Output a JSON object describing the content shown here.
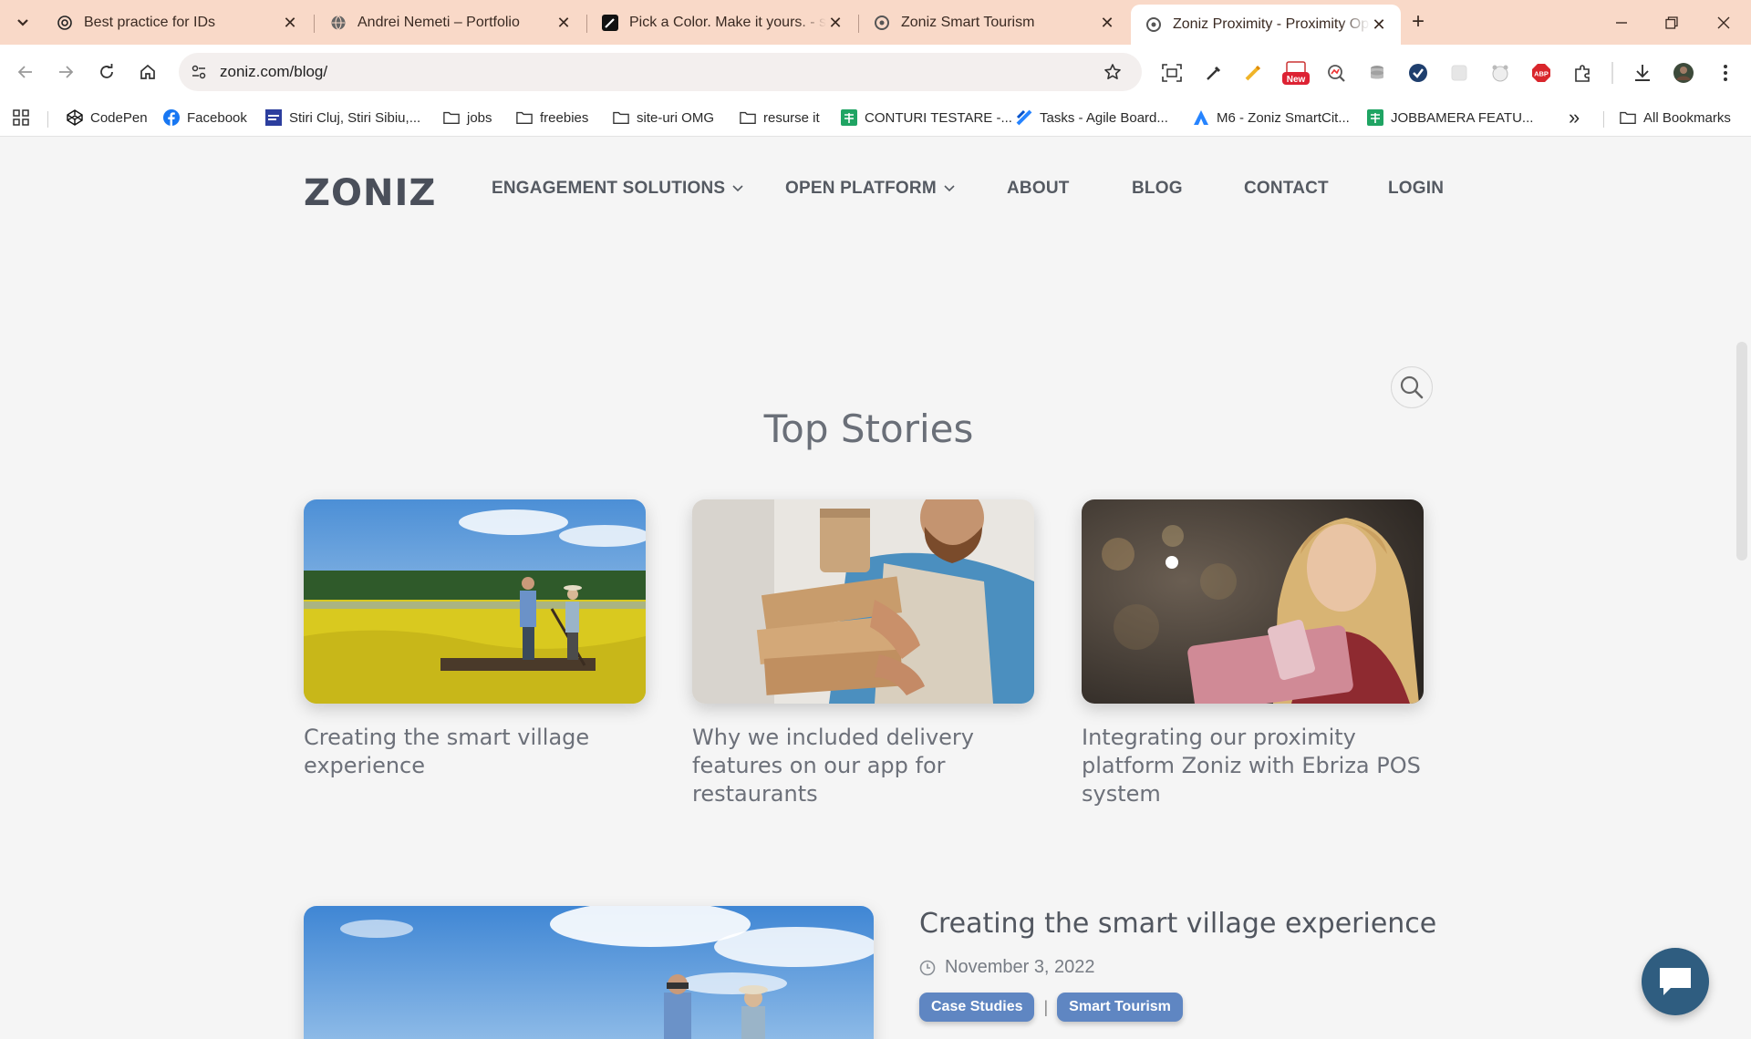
{
  "browser": {
    "tabs": [
      {
        "title": "Best practice for IDs",
        "icon": "openai-icon",
        "active": false
      },
      {
        "title": "Andrei Nemeti – Portfolio",
        "icon": "globe-icon",
        "active": false
      },
      {
        "title": "Pick a Color. Make it yours. - sh",
        "icon": "pen-icon",
        "active": false
      },
      {
        "title": "Zoniz Smart Tourism",
        "icon": "zoniz-icon",
        "active": false
      },
      {
        "title": "Zoniz Proximity - Proximity Ope",
        "icon": "zoniz-icon",
        "active": true
      }
    ],
    "url": "zoniz.com/blog/",
    "new_badge": "New",
    "abp_badge": "ABP",
    "bookmarks": [
      {
        "label": "CodePen",
        "icon": "codepen-icon"
      },
      {
        "label": "Facebook",
        "icon": "facebook-icon"
      },
      {
        "label": "Stiri Cluj, Stiri Sibiu,...",
        "icon": "news-icon"
      },
      {
        "label": "jobs",
        "icon": "folder-icon"
      },
      {
        "label": "freebies",
        "icon": "folder-icon"
      },
      {
        "label": "site-uri OMG",
        "icon": "folder-icon"
      },
      {
        "label": "resurse it",
        "icon": "folder-icon"
      },
      {
        "label": "CONTURI TESTARE -...",
        "icon": "sheets-icon"
      },
      {
        "label": "Tasks - Agile Board...",
        "icon": "jira-icon"
      },
      {
        "label": "M6 - Zoniz SmartCit...",
        "icon": "atlassian-icon"
      },
      {
        "label": "JOBBAMERA FEATU...",
        "icon": "sheets-icon"
      }
    ],
    "all_bookmarks": "All Bookmarks",
    "overflow": "»"
  },
  "site": {
    "logo": "ZONIZ",
    "nav": [
      {
        "label": "ENGAGEMENT SOLUTIONS",
        "dropdown": true
      },
      {
        "label": "OPEN PLATFORM",
        "dropdown": true
      },
      {
        "label": "ABOUT",
        "dropdown": false
      },
      {
        "label": "BLOG",
        "dropdown": false
      },
      {
        "label": "CONTACT",
        "dropdown": false
      },
      {
        "label": "LOGIN",
        "dropdown": false
      }
    ]
  },
  "blog": {
    "section_title": "Top Stories",
    "top_stories": [
      {
        "title": "Creating the smart village experience",
        "image": "birdwatchers-meadow"
      },
      {
        "title": "Why we included delivery features on our app for restaurants",
        "image": "delivery-boxes"
      },
      {
        "title": "Integrating our proximity platform Zoniz with Ebriza POS system",
        "image": "woman-smartphone"
      }
    ],
    "featured": {
      "title": "Creating the smart village experience",
      "date": "November 3, 2022",
      "tags": [
        "Case Studies",
        "Smart Tourism"
      ],
      "separator": "|"
    }
  },
  "colors": {
    "tabbar": "#f9d9c8",
    "tag": "#5f86c2",
    "chat": "#2f5d80",
    "page_bg": "#f5f5f5"
  }
}
